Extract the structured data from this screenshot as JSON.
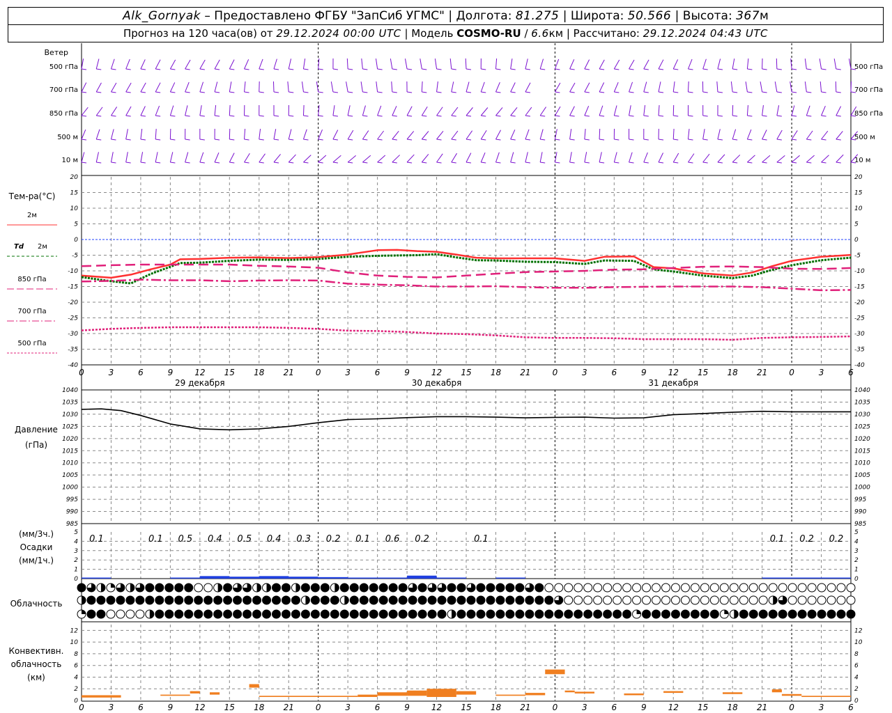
{
  "header": {
    "station": "Alk_Gornyak",
    "dash": "–",
    "provided": "Предоставлено ФГБУ \"ЗапСиб УГМС\"",
    "sep": "|",
    "lon_label": "Долгота:",
    "lon_value": "81.275",
    "lat_label": "Широта:",
    "lat_value": "50.566",
    "alt_label": "Высота:",
    "alt_value": "367",
    "alt_unit": "м",
    "forecast_label": "Прогноз на 120 часа(ов) от",
    "forecast_start": "29.12.2024 00:00 UTC",
    "model_label": "Модель",
    "model_name": "COSMO-RU",
    "model_res": "6.6",
    "model_res_unit": "км",
    "calc_label": "Рассчитано:",
    "calc_time": "29.12.2024 04:43 UTC"
  },
  "wind_panel": {
    "title": "Ветер",
    "levels": [
      "500 гПа",
      "700 гПа",
      "850 гПа",
      "500 м",
      "10 м"
    ]
  },
  "temp_panel": {
    "title": "Тем-ра(°C)",
    "legend": [
      {
        "id": "t2m",
        "label": "2м",
        "color": "#ff3030"
      },
      {
        "id": "td2m",
        "label_prefix": "Td",
        "label": "2м",
        "color": "#007000"
      },
      {
        "id": "t850",
        "label": "850 гПа",
        "color": "#e0207a"
      },
      {
        "id": "t700",
        "label": "700 гПа",
        "color": "#e0207a"
      },
      {
        "id": "t500",
        "label": "500 гПа",
        "color": "#e0207a"
      }
    ],
    "yticks": [
      "20",
      "15",
      "10",
      "5",
      "0",
      "-5",
      "-10",
      "-15",
      "-20",
      "-25",
      "-30",
      "-35",
      "-40"
    ]
  },
  "time_axis": {
    "hour_labels": [
      "0",
      "3",
      "6",
      "9",
      "12",
      "15",
      "18",
      "21",
      "0",
      "3",
      "6",
      "9",
      "12",
      "15",
      "18",
      "21",
      "0",
      "3",
      "6",
      "9",
      "12",
      "15",
      "18",
      "21",
      "0",
      "3",
      "6"
    ],
    "day_labels": [
      "29 декабря",
      "30 декабря",
      "31 декабря"
    ]
  },
  "pressure_panel": {
    "title": "Давление",
    "unit": "(гПа)",
    "yticks": [
      "1040",
      "1035",
      "1030",
      "1025",
      "1020",
      "1015",
      "1010",
      "1005",
      "1000",
      "995",
      "990",
      "985"
    ]
  },
  "precip_panel": {
    "unit_3h": "(мм/3ч.)",
    "title": "Осадки",
    "unit_1h": "(мм/1ч.)",
    "yticks": [
      "5",
      "4",
      "3",
      "2",
      "1",
      "0"
    ],
    "labels": [
      {
        "h": 3,
        "text": "0.1"
      },
      {
        "h": 9,
        "text": "0.1"
      },
      {
        "h": 12,
        "text": "0.5"
      },
      {
        "h": 15,
        "text": "0.4"
      },
      {
        "h": 18,
        "text": "0.5"
      },
      {
        "h": 21,
        "text": "0.4"
      },
      {
        "h": 24,
        "text": "0.3"
      },
      {
        "h": 27,
        "text": "0.2"
      },
      {
        "h": 30,
        "text": "0.1"
      },
      {
        "h": 33,
        "text": "0.6"
      },
      {
        "h": 36,
        "text": "0.2"
      },
      {
        "h": 42,
        "text": "0.1"
      },
      {
        "h": 72,
        "text": "0.1"
      },
      {
        "h": 75,
        "text": "0.2"
      },
      {
        "h": 78,
        "text": "0.2"
      }
    ]
  },
  "cloud_panel": {
    "title": "Облачность"
  },
  "conv_panel": {
    "title1": "Конвективн.",
    "title2": "облачность",
    "unit": "(км)",
    "yticks": [
      "12",
      "10",
      "8",
      "6",
      "4",
      "2",
      "0"
    ]
  },
  "colors": {
    "wind": "#7a10d0",
    "t2m": "#ff3030",
    "td2m": "#007000",
    "upper": "#e0207a",
    "pressure": "#000000",
    "precip": "#1f3fe0",
    "conv": "#f07f20",
    "zero_line": "#2040ff",
    "grid": "#888888"
  },
  "chart_data": [
    {
      "type": "line",
      "title": "Тем-ра(°C)",
      "x_unit": "hours since 29.12.2024 00:00 UTC",
      "ylim": [
        -40,
        20
      ],
      "grid": true,
      "series": [
        {
          "name": "2м",
          "x": [
            0,
            3,
            5,
            7,
            9,
            10,
            12,
            15,
            18,
            21,
            24,
            27,
            30,
            32,
            34,
            36,
            38,
            40,
            42,
            45,
            48,
            51,
            53,
            56,
            58,
            60,
            63,
            66,
            68,
            70,
            72,
            75,
            78
          ],
          "values": [
            -11.5,
            -12.2,
            -11.2,
            -9.5,
            -8,
            -6.3,
            -6.2,
            -5.8,
            -5.7,
            -5.9,
            -5.6,
            -4.8,
            -3.4,
            -3.3,
            -3.7,
            -3.9,
            -4.8,
            -5.8,
            -6,
            -6,
            -6,
            -6.8,
            -5.5,
            -5.4,
            -8.8,
            -9.2,
            -10.8,
            -11.5,
            -10.5,
            -8.5,
            -6.8,
            -5.5,
            -4.9
          ]
        },
        {
          "name": "Td 2м",
          "x": [
            0,
            3,
            5,
            7,
            9,
            10,
            12,
            15,
            18,
            21,
            24,
            27,
            30,
            32,
            34,
            36,
            38,
            40,
            42,
            45,
            48,
            51,
            53,
            56,
            58,
            60,
            63,
            66,
            68,
            70,
            72,
            75,
            78
          ],
          "values": [
            -12,
            -13.3,
            -14,
            -11,
            -8.7,
            -7.5,
            -7.4,
            -6.8,
            -6.4,
            -6.5,
            -6.2,
            -5.5,
            -5.2,
            -5.1,
            -5,
            -4.7,
            -5.7,
            -6.6,
            -6.7,
            -7.1,
            -7.2,
            -7.8,
            -6.7,
            -6.8,
            -9.5,
            -10.2,
            -11.5,
            -12.3,
            -11.5,
            -9.7,
            -8.2,
            -6.6,
            -5.8
          ]
        },
        {
          "name": "850 гПа",
          "x": [
            0,
            3,
            6,
            9,
            12,
            15,
            18,
            21,
            24,
            27,
            30,
            33,
            36,
            39,
            42,
            45,
            48,
            51,
            54,
            57,
            60,
            63,
            66,
            69,
            72,
            75,
            78
          ],
          "values": [
            -8.5,
            -8.2,
            -8,
            -8,
            -8,
            -8,
            -8.4,
            -8.6,
            -9,
            -10.5,
            -11.5,
            -11.9,
            -12.1,
            -11.5,
            -10.9,
            -10.4,
            -10.2,
            -10,
            -9.6,
            -9.5,
            -9.1,
            -8.7,
            -8.6,
            -8.8,
            -9.3,
            -9.4,
            -9.1
          ]
        },
        {
          "name": "700 гПа",
          "x": [
            0,
            3,
            6,
            9,
            12,
            15,
            18,
            21,
            24,
            27,
            30,
            33,
            36,
            39,
            42,
            45,
            48,
            51,
            54,
            57,
            60,
            63,
            66,
            69,
            72,
            75,
            78
          ],
          "values": [
            -13.4,
            -13.2,
            -12.8,
            -13,
            -13,
            -13.3,
            -13.1,
            -13,
            -13.1,
            -14.1,
            -14.4,
            -14.6,
            -15,
            -15,
            -14.9,
            -15.2,
            -15.4,
            -15.4,
            -15.2,
            -15.1,
            -15,
            -15,
            -15,
            -15.2,
            -15.7,
            -16.2,
            -16.1
          ]
        },
        {
          "name": "500 гПа",
          "x": [
            0,
            3,
            6,
            9,
            12,
            15,
            18,
            21,
            24,
            27,
            30,
            33,
            36,
            39,
            42,
            45,
            48,
            51,
            54,
            57,
            60,
            63,
            66,
            69,
            72,
            75,
            78
          ],
          "values": [
            -29,
            -28.5,
            -28.2,
            -28,
            -28,
            -28,
            -28,
            -28.2,
            -28.5,
            -29.1,
            -29.2,
            -29.5,
            -30,
            -30.2,
            -30.6,
            -31.2,
            -31.4,
            -31.4,
            -31.5,
            -31.8,
            -31.8,
            -31.8,
            -32,
            -31.4,
            -31.2,
            -31.1,
            -30.9
          ]
        }
      ]
    },
    {
      "type": "line",
      "title": "Давление",
      "x_unit": "hours since 29.12.2024 00:00 UTC",
      "ylim": [
        985,
        1040
      ],
      "grid": true,
      "series": [
        {
          "name": "Давление",
          "x": [
            0,
            2,
            4,
            6,
            9,
            12,
            15,
            18,
            21,
            24,
            27,
            30,
            33,
            36,
            39,
            42,
            45,
            48,
            51,
            54,
            57,
            60,
            63,
            66,
            69,
            72,
            75,
            78
          ],
          "values": [
            1032,
            1032.2,
            1031.5,
            1029.5,
            1026,
            1024,
            1023.6,
            1024,
            1025,
            1026.5,
            1027.8,
            1028.1,
            1028.6,
            1029,
            1029,
            1028.8,
            1028.5,
            1028.7,
            1028.8,
            1028.4,
            1028.5,
            1029.8,
            1030.3,
            1030.8,
            1031.2,
            1031,
            1031,
            1031
          ]
        }
      ]
    },
    {
      "type": "bar",
      "title": "Осадки",
      "x_unit": "hours since 29.12.2024 00:00 UTC",
      "ylim": [
        0,
        5
      ],
      "bars": [
        {
          "x0": 0,
          "x1": 3,
          "value": 0.03
        },
        {
          "x0": 9,
          "x1": 12,
          "value": 0.05
        },
        {
          "x0": 12,
          "x1": 15,
          "value": 0.17
        },
        {
          "x0": 15,
          "x1": 18,
          "value": 0.13
        },
        {
          "x0": 18,
          "x1": 21,
          "value": 0.17
        },
        {
          "x0": 21,
          "x1": 24,
          "value": 0.13
        },
        {
          "x0": 24,
          "x1": 27,
          "value": 0.1
        },
        {
          "x0": 27,
          "x1": 30,
          "value": 0.07
        },
        {
          "x0": 30,
          "x1": 33,
          "value": 0.05
        },
        {
          "x0": 33,
          "x1": 36,
          "value": 0.2
        },
        {
          "x0": 36,
          "x1": 39,
          "value": 0.07
        },
        {
          "x0": 42,
          "x1": 45,
          "value": 0.03
        },
        {
          "x0": 69,
          "x1": 72,
          "value": 0.03
        },
        {
          "x0": 72,
          "x1": 75,
          "value": 0.07
        },
        {
          "x0": 75,
          "x1": 78,
          "value": 0.07
        }
      ]
    },
    {
      "type": "bar",
      "title": "Конвективн. облачность",
      "x_unit": "hours since 29.12.2024 00:00 UTC",
      "ylim": [
        0,
        13
      ],
      "bars": [
        {
          "x0": 0,
          "x1": 4,
          "base": 0.5,
          "top": 0.9
        },
        {
          "x0": 8,
          "x1": 11,
          "base": 0.8,
          "top": 1.0
        },
        {
          "x0": 11,
          "x1": 12,
          "base": 1.2,
          "top": 1.6
        },
        {
          "x0": 13,
          "x1": 14,
          "base": 1.0,
          "top": 1.4
        },
        {
          "x0": 17,
          "x1": 18,
          "base": 2.2,
          "top": 2.8
        },
        {
          "x0": 18,
          "x1": 28,
          "base": 0.6,
          "top": 0.8
        },
        {
          "x0": 28,
          "x1": 30,
          "base": 0.6,
          "top": 1.0
        },
        {
          "x0": 30,
          "x1": 33,
          "base": 0.8,
          "top": 1.4
        },
        {
          "x0": 33,
          "x1": 35,
          "base": 0.8,
          "top": 1.7
        },
        {
          "x0": 35,
          "x1": 38,
          "base": 0.6,
          "top": 2.0
        },
        {
          "x0": 38,
          "x1": 40,
          "base": 1.0,
          "top": 1.6
        },
        {
          "x0": 42,
          "x1": 45,
          "base": 0.8,
          "top": 1.0
        },
        {
          "x0": 45,
          "x1": 47,
          "base": 0.9,
          "top": 1.3
        },
        {
          "x0": 47,
          "x1": 49,
          "base": 4.5,
          "top": 5.3
        },
        {
          "x0": 49,
          "x1": 50,
          "base": 1.4,
          "top": 1.7
        },
        {
          "x0": 50,
          "x1": 52,
          "base": 1.2,
          "top": 1.5
        },
        {
          "x0": 55,
          "x1": 57,
          "base": 0.9,
          "top": 1.2
        },
        {
          "x0": 59,
          "x1": 61,
          "base": 1.3,
          "top": 1.6
        },
        {
          "x0": 65,
          "x1": 67,
          "base": 1.1,
          "top": 1.4
        },
        {
          "x0": 70,
          "x1": 71,
          "base": 1.4,
          "top": 1.9
        },
        {
          "x0": 71,
          "x1": 73,
          "base": 0.8,
          "top": 1.1
        },
        {
          "x0": 73,
          "x1": 78,
          "base": 0.6,
          "top": 0.8
        }
      ]
    }
  ]
}
